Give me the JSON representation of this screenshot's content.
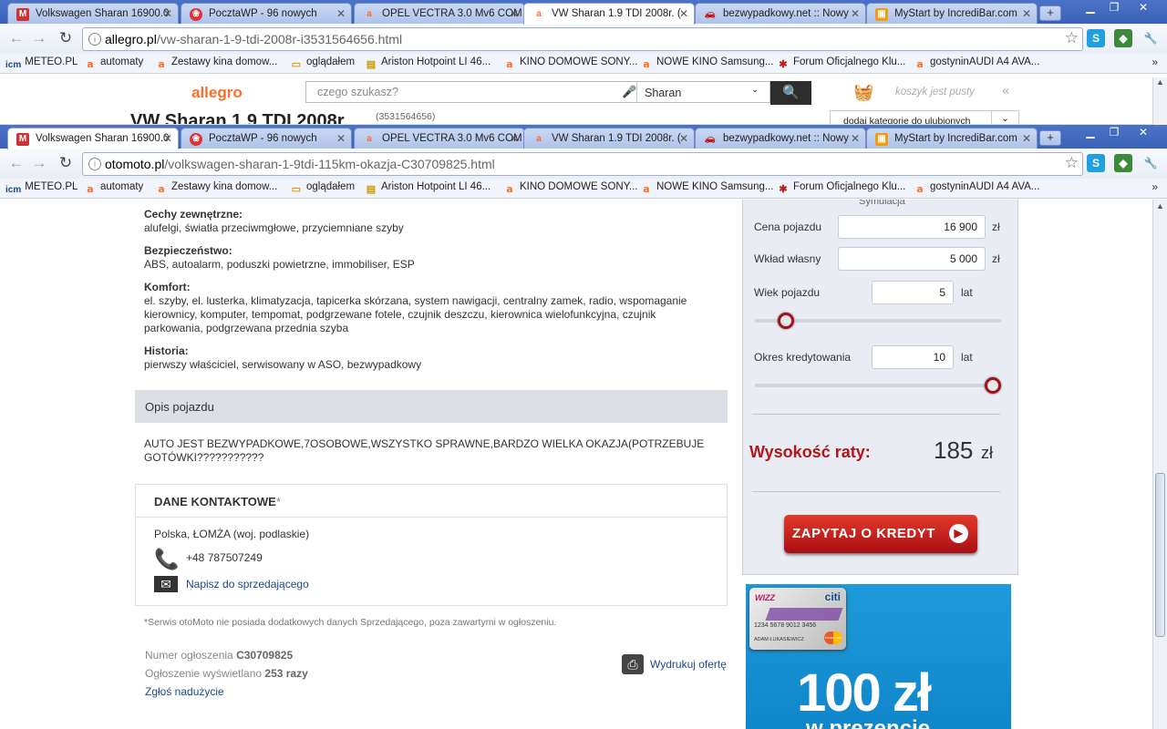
{
  "browser_back": {
    "tabs": [
      "Volkswagen Sharan 16900.0",
      "PocztaWP - 96 nowych",
      "OPEL VECTRA 3.0 Mv6 COM",
      "VW Sharan 1.9 TDI 2008r. (",
      "bezwypadkowy.net :: Nowy",
      "MyStart by IncrediBar.com"
    ],
    "active_tab": 3,
    "url_host": "allegro.pl",
    "url_path": "/vw-sharan-1-9-tdi-2008r-i3531564656.html",
    "allegro": {
      "logo": "allegro",
      "search_placeholder": "czego szukasz?",
      "category": "Sharan",
      "cart": "koszyk jest pusty",
      "collapse": "«",
      "title": "VW Sharan 1.9 TDI 2008r.",
      "item_id": "(3531564656)",
      "fav_category": "dodaj kategorię do ulubionych"
    }
  },
  "browser_front": {
    "tabs": [
      "Volkswagen Sharan 16900.0",
      "PocztaWP - 96 nowych",
      "OPEL VECTRA 3.0 Mv6 COM",
      "VW Sharan 1.9 TDI 2008r. (",
      "bezwypadkowy.net :: Nowy",
      "MyStart by IncrediBar.com"
    ],
    "active_tab": 0,
    "url_host": "otomoto.pl",
    "url_path": "/volkswagen-sharan-1-9tdi-115km-okazja-C30709825.html"
  },
  "bookmarks": [
    "METEO.PL",
    "automaty",
    "Zestawy kina domow...",
    "oglądałem",
    "Ariston Hotpoint LI 46...",
    "KINO DOMOWE SONY...",
    "NOWE KINO Samsung...",
    "Forum Oficjalnego Klu...",
    "gostyninAUDI A4 AVA..."
  ],
  "bookmark_logo": "icm",
  "features": [
    {
      "label": "Cechy zewnętrzne:",
      "text": "alufelgi, światła przeciwmgłowe, przyciemniane szyby"
    },
    {
      "label": "Bezpieczeństwo:",
      "text": "ABS, autoalarm, poduszki powietrzne, immobiliser, ESP"
    },
    {
      "label": "Komfort:",
      "text": "el. szyby, el. lusterka, klimatyzacja, tapicerka skórzana, system nawigacji, centralny zamek, radio, wspomaganie kierownicy, komputer, tempomat, podgrzewane fotele, czujnik deszczu, kierownica wielofunkcyjna, czujnik parkowania, podgrzewana przednia szyba"
    },
    {
      "label": "Historia:",
      "text": "pierwszy właściciel, serwisowany w ASO, bezwypadkowy"
    }
  ],
  "description": {
    "header": "Opis pojazdu",
    "text": "AUTO JEST BEZWYPADKOWE,7OSOBOWE,WSZYSTKO SPRAWNE,BARDZO WIELKA OKAZJA(POTRZEBUJE GOTÓWKI???????????"
  },
  "contact": {
    "header": "DANE KONTAKTOWE",
    "asterisk": "*",
    "location": "Polska, ŁOMŻA (woj. podlaskie)",
    "phone": "+48 787507249",
    "message_link": "Napisz do sprzedającego",
    "footnote": "*Serwis otoMoto nie posiada dodatkowych danych Sprzedającego, poza zawartymi w ogłoszeniu."
  },
  "listing": {
    "number_label": "Numer ogłoszenia",
    "number": "C30709825",
    "views_label": "Ogłoszenie wyświetlano",
    "views": "253 razy",
    "report": "Zgłoś nadużycie",
    "print": "Wydrukuj ofertę"
  },
  "calculator": {
    "title": "Symulacja",
    "price_label": "Cena pojazdu",
    "price": "16 900",
    "deposit_label": "Wkład własny",
    "deposit": "5 000",
    "currency": "zł",
    "age_label": "Wiek pojazdu",
    "age": "5",
    "age_slider_fraction": 0.1,
    "period_label": "Okres kredytowania",
    "period": "10",
    "period_slider_fraction": 1.0,
    "years": "lat",
    "rate_label": "Wysokość raty:",
    "rate_value": "185",
    "rate_currency": "zł",
    "button": "ZAPYTAJ O KREDYT"
  },
  "promo": {
    "brand1": "WIZZ",
    "brand2": "citi",
    "card_number": "1234 5678 9012 3456",
    "card_holder": "ADAM ŁUKASIEWICZ",
    "card_brand": "MasterCard",
    "amount": "100 zł",
    "sub": "w prezencie"
  },
  "colors": {
    "accent_red": "#b3151b",
    "link_blue": "#1a4a8c",
    "allegro_orange": "#ff6d2b"
  }
}
